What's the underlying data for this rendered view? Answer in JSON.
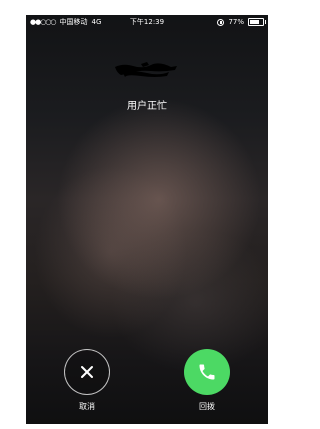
{
  "status_bar": {
    "signal": "●●○○○",
    "carrier": "中国移动",
    "network": "4G",
    "time": "下午12:39",
    "battery": "77%",
    "battery_level": 0.77
  },
  "call": {
    "status": "用户正忙"
  },
  "actions": {
    "cancel_label": "取消",
    "callback_label": "回拨"
  },
  "colors": {
    "accept_green": "#4cd964",
    "text": "#ffffff"
  }
}
